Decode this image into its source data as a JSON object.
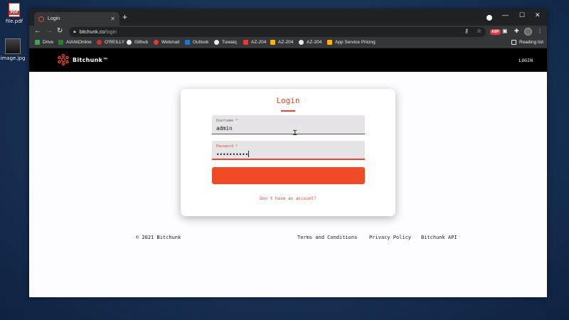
{
  "desktop": {
    "icons": [
      {
        "label": "file.pdf",
        "icon": "pdf-file-icon"
      },
      {
        "label": "image.jpg",
        "icon": "image-file-icon"
      }
    ]
  },
  "browser": {
    "tab": {
      "title": "Login",
      "close": "✕"
    },
    "new_tab": "+",
    "window_controls": {
      "minimize": "—",
      "maximize": "☐",
      "close": "✕"
    },
    "address": {
      "host": "bitchunk.co",
      "path": "/login"
    },
    "bookmarks": [
      {
        "label": "Drive",
        "color": "#34a853"
      },
      {
        "label": "AIAhliOnline",
        "color": "#2e7d32"
      },
      {
        "label": "O'REILLY",
        "color": "#d32f2f"
      },
      {
        "label": "Github",
        "color": "#e8eaed"
      },
      {
        "label": "Webmail",
        "color": "#e53935"
      },
      {
        "label": "Outlook",
        "color": "#1976d2"
      },
      {
        "label": "Tuwaiq",
        "color": "#e8eaed"
      },
      {
        "label": "AZ-204",
        "color": "#e53935"
      },
      {
        "label": "AZ-204",
        "color": "#ffb300"
      },
      {
        "label": "AZ-204",
        "color": "#e8eaed"
      },
      {
        "label": "App Service Pricing",
        "color": "#ffb300"
      }
    ],
    "reading_list": "Reading list",
    "extension_badge": "ABP"
  },
  "app": {
    "brand": "Bitchunk™",
    "nav_login": "LOGIN",
    "accent": "#e5472b",
    "login_card": {
      "title": "Login",
      "username": {
        "label": "Username *",
        "value": "admin"
      },
      "password": {
        "label": "Password *",
        "value": "••••••••••"
      },
      "submit_label": "",
      "signup_link": "Don't have an account?"
    },
    "footer": {
      "copyright": "© 2021 Bitchunk",
      "links": [
        "Terms and Conditions",
        "Privacy Policy",
        "Bitchunk API"
      ]
    }
  }
}
